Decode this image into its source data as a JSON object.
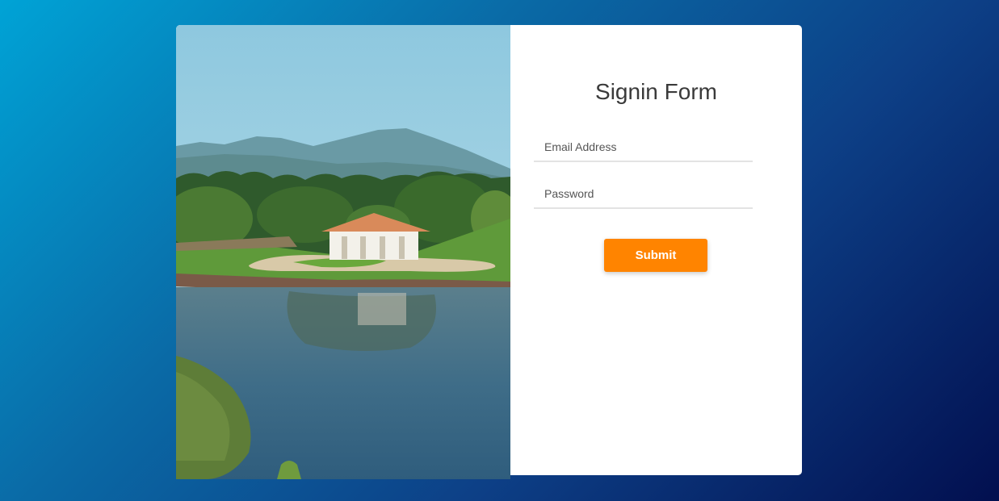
{
  "form": {
    "title": "Signin Form",
    "email_placeholder": "Email Address",
    "email_value": "",
    "password_placeholder": "Password",
    "password_value": "",
    "submit_label": "Submit"
  },
  "photo": {
    "subject": "landscape-photo"
  },
  "colors": {
    "background_start": "#00a3d6",
    "background_end": "#020f4f",
    "card": "#ffffff",
    "submit_button": "#ff8400",
    "title_text": "#3a3a3a"
  }
}
